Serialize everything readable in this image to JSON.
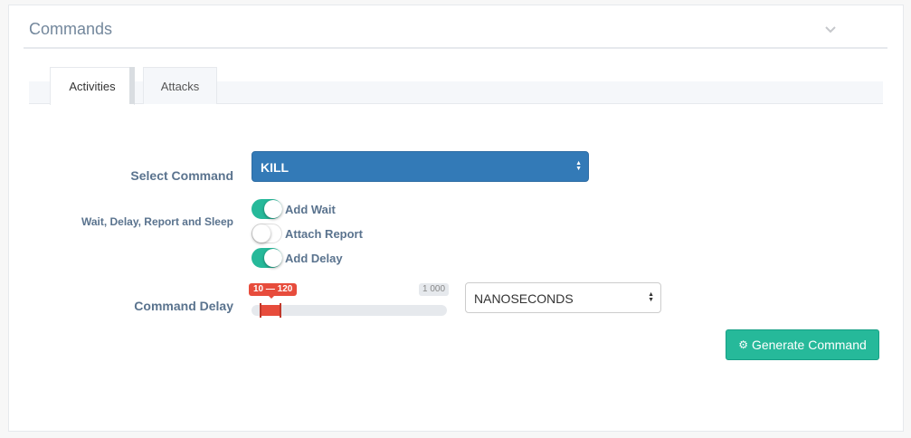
{
  "panel": {
    "title": "Commands",
    "collapse_icon": "chevron-down-icon"
  },
  "tabs": [
    {
      "label": "Activities",
      "active": true
    },
    {
      "label": "Attacks",
      "active": false
    }
  ],
  "form": {
    "select_command": {
      "label": "Select Command",
      "value": "KILL"
    },
    "wait_group": {
      "label": "Wait, Delay, Report and Sleep",
      "switches": [
        {
          "label": "Add Wait",
          "on": true
        },
        {
          "label": "Attach Report",
          "on": false
        },
        {
          "label": "Add Delay",
          "on": true
        }
      ]
    },
    "command_delay": {
      "label": "Command Delay",
      "range_label": "10 — 120",
      "from": 10,
      "to": 120,
      "max": 1000,
      "max_label": "1 000",
      "unit": "NANOSECONDS"
    }
  },
  "actions": {
    "generate_label": "Generate Command",
    "generate_icon": "gear-icon"
  },
  "colors": {
    "accent_green": "#26b99a",
    "select_blue": "#337ab7",
    "slider_red": "#e74c3c"
  }
}
